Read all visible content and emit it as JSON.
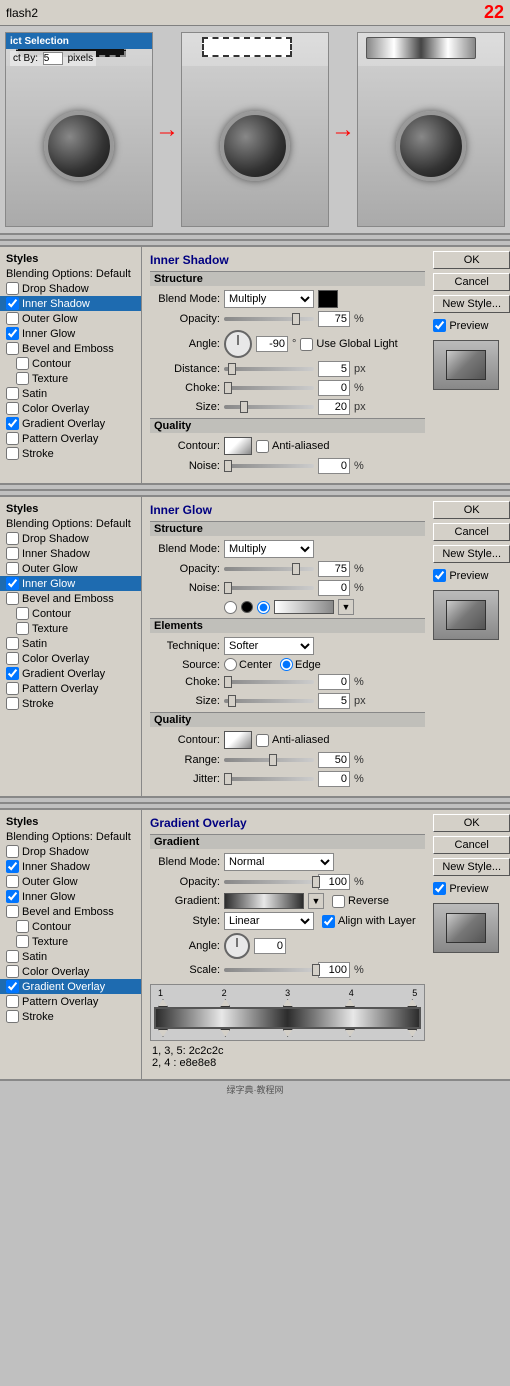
{
  "topbar": {
    "title": "flash2",
    "page_num": "22"
  },
  "camera_section": {
    "arrow1": "→",
    "arrow2": "→",
    "panel1": {
      "selection_label": "ict Selection",
      "pixels_label": "ct By:",
      "pixels_value": "5",
      "pixels_unit": "pixels"
    },
    "panel2": {
      "dashed_rect": true
    },
    "panel3": {
      "gradient_rect": true
    }
  },
  "inner_shadow": {
    "title": "Inner Shadow",
    "structure_label": "Structure",
    "blend_mode_label": "Blend Mode:",
    "blend_mode_value": "Multiply",
    "opacity_label": "Opacity:",
    "opacity_value": "75",
    "opacity_unit": "%",
    "angle_label": "Angle:",
    "angle_value": "-90",
    "angle_unit": "°",
    "use_global_light_label": "Use Global Light",
    "distance_label": "Distance:",
    "distance_value": "5",
    "distance_unit": "px",
    "choke_label": "Choke:",
    "choke_value": "0",
    "choke_unit": "%",
    "size_label": "Size:",
    "size_value": "20",
    "size_unit": "px",
    "quality_label": "Quality",
    "contour_label": "Contour:",
    "anti_aliased_label": "Anti-aliased",
    "noise_label": "Noise:",
    "noise_value": "0",
    "noise_unit": "%"
  },
  "inner_glow": {
    "title": "Inner Glow",
    "structure_label": "Structure",
    "blend_mode_label": "Blend Mode:",
    "blend_mode_value": "Multiply",
    "opacity_label": "Opacity:",
    "opacity_value": "75",
    "opacity_unit": "%",
    "noise_label": "Noise:",
    "noise_value": "0",
    "noise_unit": "%",
    "elements_label": "Elements",
    "technique_label": "Technique:",
    "technique_value": "Softer",
    "source_label": "Source:",
    "center_label": "Center",
    "edge_label": "Edge",
    "choke_label": "Choke:",
    "choke_value": "0",
    "choke_unit": "%",
    "size_label": "Size:",
    "size_value": "5",
    "size_unit": "px",
    "quality_label": "Quality",
    "contour_label": "Contour:",
    "anti_aliased_label": "Anti-aliased",
    "range_label": "Range:",
    "range_value": "50",
    "range_unit": "%",
    "jitter_label": "Jitter:",
    "jitter_value": "0",
    "jitter_unit": "%"
  },
  "gradient_overlay": {
    "title": "Gradient Overlay",
    "gradient_label": "Gradient",
    "blend_mode_label": "Blend Mode:",
    "blend_mode_value": "Normal",
    "opacity_label": "Opacity:",
    "opacity_value": "100",
    "opacity_unit": "%",
    "gradient_field_label": "Gradient:",
    "reverse_label": "Reverse",
    "style_label": "Style:",
    "style_value": "Linear",
    "align_with_layer_label": "Align with Layer",
    "angle_label": "Angle:",
    "angle_value": "0",
    "scale_label": "Scale:",
    "scale_value": "100",
    "scale_unit": "%"
  },
  "gradient_bar": {
    "stops": [
      {
        "num": "1",
        "pos": "0",
        "color": "#2c2c2c"
      },
      {
        "num": "2",
        "pos": "25",
        "color": "#e8e8e8"
      },
      {
        "num": "3",
        "pos": "50",
        "color": "#2c2c2c"
      },
      {
        "num": "4",
        "pos": "75",
        "color": "#e8e8e8"
      },
      {
        "num": "5",
        "pos": "100",
        "color": "#2c2c2c"
      }
    ],
    "note1": "1, 3, 5: 2c2c2c",
    "note2": "2, 4   : e8e8e8"
  },
  "styles_panels": {
    "panel1": {
      "title": "Styles",
      "blending_options": "Blending Options: Default",
      "items": [
        {
          "label": "Drop Shadow",
          "checked": false,
          "active": false
        },
        {
          "label": "Inner Shadow",
          "checked": true,
          "active": true
        },
        {
          "label": "Outer Glow",
          "checked": false,
          "active": false
        },
        {
          "label": "Inner Glow",
          "checked": true,
          "active": false
        },
        {
          "label": "Bevel and Emboss",
          "checked": false,
          "active": false
        },
        {
          "label": "Contour",
          "checked": false,
          "active": false,
          "indent": true
        },
        {
          "label": "Texture",
          "checked": false,
          "active": false,
          "indent": true
        },
        {
          "label": "Satin",
          "checked": false,
          "active": false
        },
        {
          "label": "Color Overlay",
          "checked": false,
          "active": false
        },
        {
          "label": "Gradient Overlay",
          "checked": true,
          "active": false
        },
        {
          "label": "Pattern Overlay",
          "checked": false,
          "active": false
        },
        {
          "label": "Stroke",
          "checked": false,
          "active": false
        }
      ]
    },
    "panel2": {
      "title": "Styles",
      "blending_options": "Blending Options: Default",
      "items": [
        {
          "label": "Drop Shadow",
          "checked": false,
          "active": false
        },
        {
          "label": "Inner Shadow",
          "checked": false,
          "active": false
        },
        {
          "label": "Outer Glow",
          "checked": false,
          "active": false
        },
        {
          "label": "Inner Glow",
          "checked": true,
          "active": true
        },
        {
          "label": "Bevel and Emboss",
          "checked": false,
          "active": false
        },
        {
          "label": "Contour",
          "checked": false,
          "active": false,
          "indent": true
        },
        {
          "label": "Texture",
          "checked": false,
          "active": false,
          "indent": true
        },
        {
          "label": "Satin",
          "checked": false,
          "active": false
        },
        {
          "label": "Color Overlay",
          "checked": false,
          "active": false
        },
        {
          "label": "Gradient Overlay",
          "checked": true,
          "active": false
        },
        {
          "label": "Pattern Overlay",
          "checked": false,
          "active": false
        },
        {
          "label": "Stroke",
          "checked": false,
          "active": false
        }
      ]
    },
    "panel3": {
      "title": "Styles",
      "blending_options": "Blending Options: Default",
      "items": [
        {
          "label": "Drop Shadow",
          "checked": false,
          "active": false
        },
        {
          "label": "Inner Shadow",
          "checked": true,
          "active": false
        },
        {
          "label": "Outer Glow",
          "checked": false,
          "active": false
        },
        {
          "label": "Inner Glow",
          "checked": true,
          "active": false
        },
        {
          "label": "Bevel and Emboss",
          "checked": false,
          "active": false
        },
        {
          "label": "Contour",
          "checked": false,
          "active": false,
          "indent": true
        },
        {
          "label": "Texture",
          "checked": false,
          "active": false,
          "indent": true
        },
        {
          "label": "Satin",
          "checked": false,
          "active": false
        },
        {
          "label": "Color Overlay",
          "checked": false,
          "active": false
        },
        {
          "label": "Gradient Overlay",
          "checked": true,
          "active": true
        },
        {
          "label": "Pattern Overlay",
          "checked": false,
          "active": false
        },
        {
          "label": "Stroke",
          "checked": false,
          "active": false
        }
      ]
    }
  },
  "buttons": {
    "ok": "OK",
    "cancel": "Cancel",
    "new_style": "New Style...",
    "preview": "Preview"
  }
}
